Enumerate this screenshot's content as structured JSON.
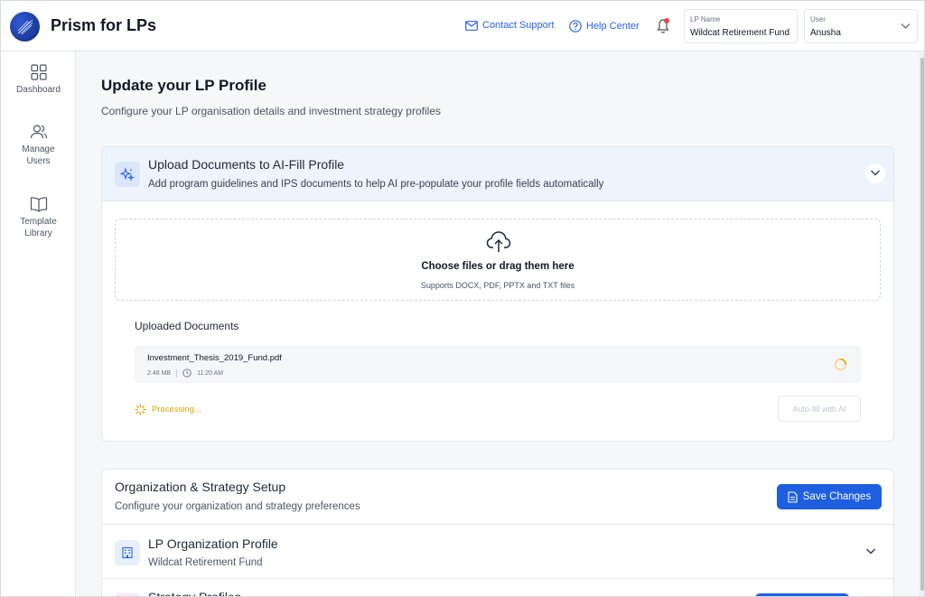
{
  "app": {
    "title": "Prism for LPs"
  },
  "header": {
    "contact_support": "Contact Support",
    "help_center": "Help Center",
    "lp_name_label": "LP Name",
    "lp_name_value": "Wildcat Retirement Fund",
    "user_label": "User",
    "user_value": "Anusha"
  },
  "sidebar": {
    "items": [
      {
        "label": "Dashboard",
        "icon": "grid-icon"
      },
      {
        "label": "Manage Users",
        "icon": "users-icon"
      },
      {
        "label": "Template Library",
        "icon": "book-icon"
      }
    ]
  },
  "page": {
    "title": "Update your LP Profile",
    "subtitle": "Configure your LP organisation details and investment strategy profiles"
  },
  "upload_card": {
    "title": "Upload Documents to AI-Fill Profile",
    "subtitle": "Add program guidelines and IPS documents to help AI pre-populate your profile fields automatically",
    "dropzone_title": "Choose files or drag them here",
    "dropzone_sub": "Supports DOCX, PDF, PPTX and TXT files",
    "uploaded_heading": "Uploaded Documents",
    "file": {
      "name": "Investment_Thesis_2019_Fund.pdf",
      "size": "2.48 MB",
      "time": "11:20 AM"
    },
    "processing_text": "Processing...",
    "autofill_label": "Auto-fill with AI"
  },
  "org_card": {
    "title": "Organization & Strategy Setup",
    "subtitle": "Configure your organization and strategy preferences",
    "save_label": "Save Changes",
    "rows": [
      {
        "title": "LP Organization Profile",
        "subtitle": "Wildcat Retirement Fund"
      },
      {
        "title": "Strategy Profiles"
      }
    ]
  },
  "colors": {
    "accent": "#1d5fe0",
    "link": "#2563eb",
    "processing": "#e0a100",
    "notification": "#ef4444"
  }
}
